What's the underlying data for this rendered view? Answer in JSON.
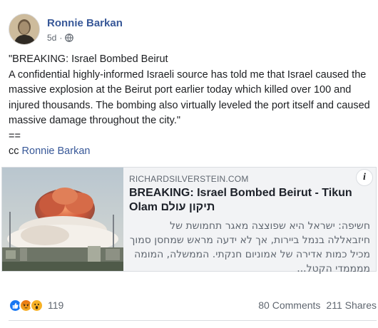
{
  "post": {
    "author": "Ronnie Barkan",
    "time": "5d",
    "separator": "·",
    "privacy_icon": "globe-icon",
    "text": {
      "line1": "\"BREAKING: Israel Bombed Beirut",
      "line2": "A confidential highly-informed Israeli source has told me that Israel caused the massive explosion at the Beirut port earlier today which killed over 100 and injured thousands. The bombing also virtually leveled the port itself and caused massive damage throughout the city.\"",
      "line3": "==",
      "cc_prefix": "cc",
      "cc_name": "Ronnie Barkan"
    }
  },
  "link_card": {
    "domain": "RICHARDSILVERSTEIN.COM",
    "title": "BREAKING: Israel Bombed Beirut - Tikun Olam תיקון עולם",
    "description": "חשיפה: ישראל היא שפוצצה מאגר תחמושת של חיזבאללה בנמל ביירות, אך לא ידעה מראש שמחסן סמוך מכיל כמות אדירה של אמוניום חנקתי. הממשלה, המומה ממממדי הקטל...",
    "info_icon_glyph": "i"
  },
  "footer": {
    "reactions": [
      "like-icon",
      "angry-icon",
      "wow-icon"
    ],
    "reaction_count": "119",
    "comments": "80 Comments",
    "shares": "211 Shares"
  },
  "colors": {
    "link_blue": "#385898",
    "like_blue": "#1877f2",
    "angry_orange": "#e9710f",
    "wow_yellow": "#f7b125"
  }
}
